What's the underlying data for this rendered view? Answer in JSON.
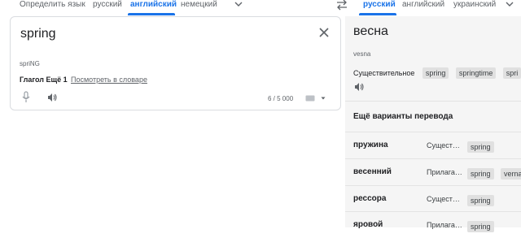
{
  "source_langs": [
    "Определить язык",
    "русский",
    "английский",
    "немецкий"
  ],
  "target_langs": [
    "русский",
    "английский",
    "украинский"
  ],
  "icons": {
    "dropdown": "chevron-down-icon",
    "swap": "swap-arrows-icon",
    "clear": "close-icon",
    "mic": "microphone-icon",
    "speaker": "speaker-icon",
    "keyboard": "keyboard-icon"
  },
  "source": {
    "text": "spring",
    "transliteration": "spriNG",
    "suggestion_label": "Глагол Ещё 1",
    "dictionary_link": "Посмотреть в словаре",
    "char_count": "6 / 5 000"
  },
  "target": {
    "text": "весна",
    "transliteration": "vesna",
    "pos_label": "Существительное",
    "chips": [
      "spring",
      "springtime",
      "spri"
    ]
  },
  "more": {
    "heading": "Ещё варианты перевода",
    "rows": [
      {
        "word": "пружина",
        "pos": "Сущест…",
        "chips": [
          "spring"
        ]
      },
      {
        "word": "весенний",
        "pos": "Прилага…",
        "chips": [
          "spring",
          "verna"
        ]
      },
      {
        "word": "рессора",
        "pos": "Сущест…",
        "chips": [
          "spring"
        ]
      },
      {
        "word": "яровой",
        "pos": "Прилага…",
        "chips": [
          "spring"
        ]
      }
    ]
  },
  "colors": {
    "accent": "#1a73e8",
    "panel": "#f5f5f5",
    "chip": "#e0e0e0"
  }
}
